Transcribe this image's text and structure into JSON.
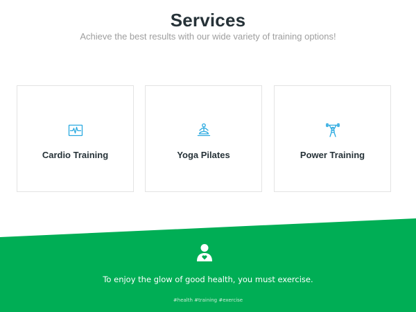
{
  "header": {
    "title": "Services",
    "subtitle": "Achieve the best results with our wide variety of training options!"
  },
  "services": [
    {
      "label": "Cardio Training",
      "icon": "heart-monitor-icon"
    },
    {
      "label": "Yoga Pilates",
      "icon": "meditation-icon"
    },
    {
      "label": "Power Training",
      "icon": "weightlifter-icon"
    }
  ],
  "footer": {
    "icon": "user-heart-icon",
    "quote": "To enjoy the glow of good health, you must exercise.",
    "tags": "#health  #training  #exercise"
  },
  "colors": {
    "accent": "#29a9e0",
    "green": "#00ae55",
    "heading": "#263238",
    "subtitle": "#9e9e9e",
    "card_border": "#e3e3e3"
  }
}
